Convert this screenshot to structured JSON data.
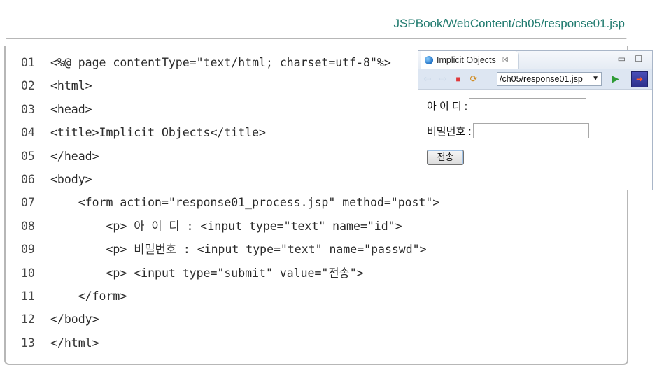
{
  "file_path": "JSPBook/WebContent/ch05/response01.jsp",
  "code_lines": [
    {
      "no": "01",
      "text": "<%@ page contentType=\"text/html; charset=utf-8\"%>"
    },
    {
      "no": "02",
      "text": "<html>"
    },
    {
      "no": "03",
      "text": "<head>"
    },
    {
      "no": "04",
      "text": "<title>Implicit Objects</title>"
    },
    {
      "no": "05",
      "text": "</head>"
    },
    {
      "no": "06",
      "text": "<body>"
    },
    {
      "no": "07",
      "text": "    <form action=\"response01_process.jsp\" method=\"post\">"
    },
    {
      "no": "08",
      "text": "        <p> 아 이 디 : <input type=\"text\" name=\"id\">"
    },
    {
      "no": "09",
      "text": "        <p> 비밀번호 : <input type=\"text\" name=\"passwd\">"
    },
    {
      "no": "10",
      "text": "        <p> <input type=\"submit\" value=\"전송\">"
    },
    {
      "no": "11",
      "text": "    </form>"
    },
    {
      "no": "12",
      "text": "</body>"
    },
    {
      "no": "13",
      "text": "</html>"
    }
  ],
  "browser": {
    "tab_title": "Implicit Objects",
    "url": "/ch05/response01.jsp",
    "form": {
      "id_label": "아 이 디 :",
      "id_value": "",
      "passwd_label": "비밀번호 :",
      "passwd_value": "",
      "submit_label": "전송"
    }
  },
  "colors": {
    "path_text": "#1f7a6e",
    "frame_border": "#b7b7b7",
    "toolbar_bg": "#dde6f2"
  }
}
